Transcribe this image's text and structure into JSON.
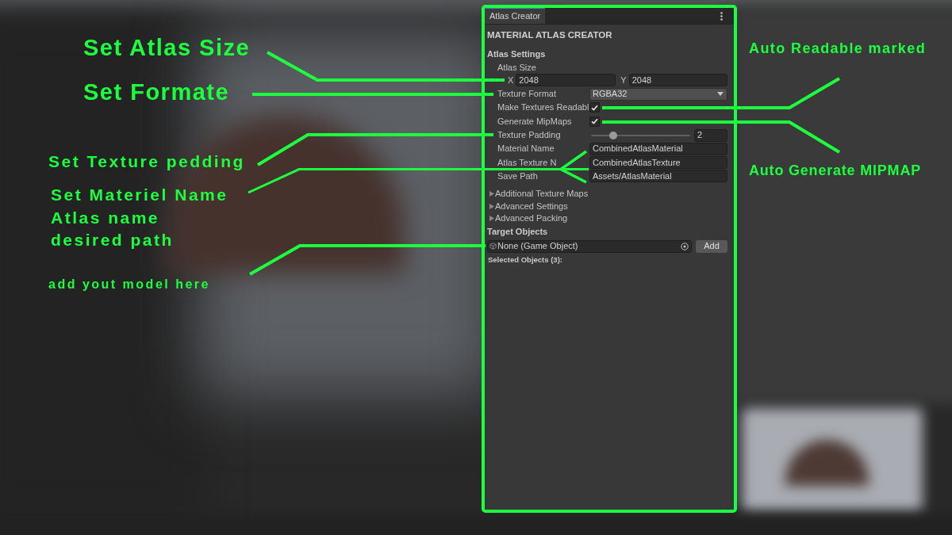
{
  "window": {
    "tab": "Atlas Creator",
    "title": "MATERIAL ATLAS CREATOR"
  },
  "atlas_settings": {
    "heading": "Atlas Settings",
    "atlas_size": {
      "label": "Atlas Size",
      "x_label": "X",
      "x_value": "2048",
      "y_label": "Y",
      "y_value": "2048"
    },
    "fields": [
      {
        "kind": "dropdown",
        "label": "Texture Format",
        "value": "RGBA32"
      },
      {
        "kind": "checkbox",
        "label": "Make Textures Readabl",
        "checked": true
      },
      {
        "kind": "checkbox",
        "label": "Generate MipMaps",
        "checked": true
      },
      {
        "kind": "slider",
        "label": "Texture Padding",
        "level": 0.2,
        "value": "2"
      },
      {
        "kind": "text",
        "label": "Material Name",
        "value": "CombinedAtlasMaterial"
      },
      {
        "kind": "text",
        "label": "Atlas Texture N",
        "value": "CombinedAtlasTexture"
      },
      {
        "kind": "text",
        "label": "Save Path",
        "value": "Assets/AtlasMaterial"
      }
    ]
  },
  "foldouts": [
    {
      "label": "Additional Texture Maps",
      "expanded": false
    },
    {
      "label": "Advanced Settings",
      "expanded": false
    },
    {
      "label": "Advanced Packing",
      "expanded": false
    }
  ],
  "target_objects": {
    "heading": "Target Objects",
    "object_field": "None (Game Object)",
    "add_button": "Add",
    "selected_label": "Selected Objects (3):"
  },
  "annotations": [
    "Set Atlas Size",
    "Auto Readable marked",
    "Set Formate",
    "Set Texture pedding",
    "Auto Generate MIPMAP",
    "Set Materiel Name\nAtlas name\ndesired path",
    "add yout model here"
  ]
}
